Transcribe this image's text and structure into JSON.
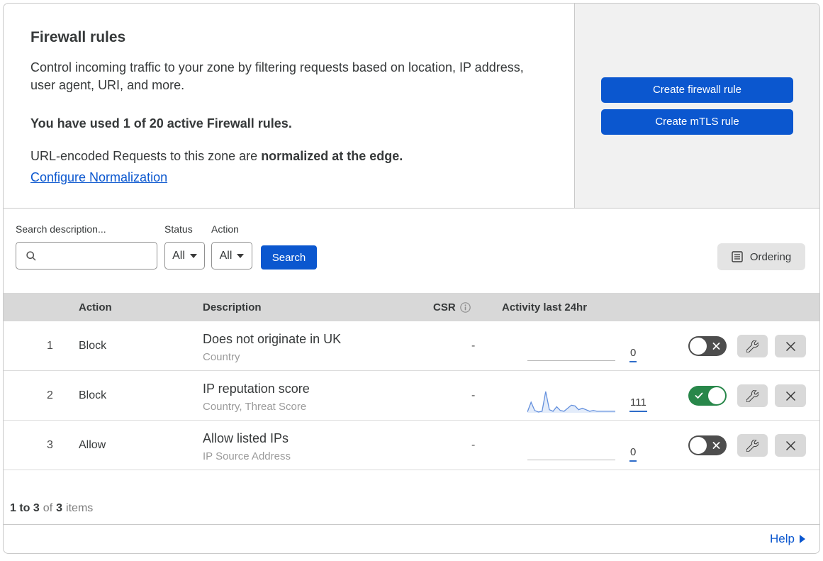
{
  "header": {
    "title": "Firewall rules",
    "description": "Control incoming traffic to your zone by filtering requests based on location, IP address, user agent, URI, and more.",
    "usage_note": "You have used 1 of 20 active Firewall rules.",
    "normalization_prefix": "URL-encoded Requests to this zone are ",
    "normalization_bold": "normalized at the edge.",
    "normalization_link": "Configure Normalization",
    "create_firewall_button": "Create firewall rule",
    "create_mtls_button": "Create mTLS rule"
  },
  "filters": {
    "search_label": "Search description...",
    "status_label": "Status",
    "status_value": "All",
    "action_label": "Action",
    "action_value": "All",
    "search_button": "Search",
    "ordering_button": "Ordering"
  },
  "table": {
    "columns": {
      "action": "Action",
      "description": "Description",
      "csr": "CSR",
      "activity": "Activity last 24hr"
    },
    "rows": [
      {
        "index": "1",
        "action": "Block",
        "description": "Does not originate in UK",
        "fields": "Country",
        "csr": "-",
        "activity_count": "0",
        "enabled": false
      },
      {
        "index": "2",
        "action": "Block",
        "description": "IP reputation score",
        "fields": "Country, Threat Score",
        "csr": "-",
        "activity_count": "111",
        "enabled": true
      },
      {
        "index": "3",
        "action": "Allow",
        "description": "Allow listed IPs",
        "fields": "IP Source Address",
        "csr": "-",
        "activity_count": "0",
        "enabled": false
      }
    ]
  },
  "footer": {
    "range_text": "1 to 3",
    "of_text": "of",
    "total_text": "3",
    "items_text": "items",
    "help_link": "Help"
  },
  "colors": {
    "accent_blue": "#0b57cf",
    "toggle_on_green": "#28874a",
    "toggle_off_gray": "#4d4d4d",
    "spark_line_blue": "#6490dd"
  },
  "chart_data": {
    "type": "area",
    "title": "Activity last 24hr sparkline for rule 2",
    "x_range_hours": 24,
    "values": [
      1,
      14,
      3,
      1,
      2,
      28,
      4,
      2,
      8,
      3,
      2,
      6,
      10,
      9,
      4,
      6,
      4,
      2,
      3,
      2,
      2,
      2,
      2,
      2,
      2
    ],
    "ylim": [
      0,
      30
    ],
    "total": 111
  }
}
